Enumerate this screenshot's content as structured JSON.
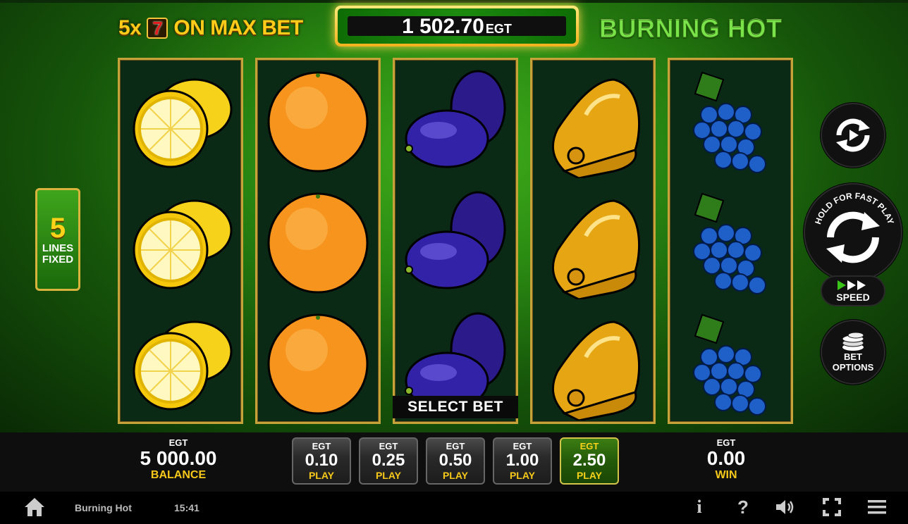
{
  "header": {
    "promo_multiplier": "5x",
    "promo_seven": "7",
    "promo_text": "ON MAX BET",
    "jackpot_amount": "1 502.70",
    "jackpot_currency": "EGT",
    "game_title": "BURNING HOT"
  },
  "reels": [
    {
      "symbols": [
        "lemon",
        "lemon",
        "lemon"
      ]
    },
    {
      "symbols": [
        "orange",
        "orange",
        "orange"
      ]
    },
    {
      "symbols": [
        "plum",
        "plum",
        "plum"
      ]
    },
    {
      "symbols": [
        "bell",
        "bell",
        "bell"
      ]
    },
    {
      "symbols": [
        "grapes",
        "grapes",
        "grapes"
      ]
    }
  ],
  "lines": {
    "count": "5",
    "label_line1": "LINES",
    "label_line2": "FIXED"
  },
  "controls": {
    "autoplay_icon": "autoplay-icon",
    "spin_hold_text": "HOLD FOR FAST PLAY",
    "speed_label": "SPEED",
    "bet_options_line1": "BET",
    "bet_options_line2": "OPTIONS"
  },
  "select_bet": "SELECT BET",
  "balance": {
    "currency": "EGT",
    "value": "5 000.00",
    "label": "BALANCE"
  },
  "win": {
    "currency": "EGT",
    "value": "0.00",
    "label": "WIN"
  },
  "bets": [
    {
      "currency": "EGT",
      "value": "0.10",
      "label": "PLAY",
      "active": false
    },
    {
      "currency": "EGT",
      "value": "0.25",
      "label": "PLAY",
      "active": false
    },
    {
      "currency": "EGT",
      "value": "0.50",
      "label": "PLAY",
      "active": false
    },
    {
      "currency": "EGT",
      "value": "1.00",
      "label": "PLAY",
      "active": false
    },
    {
      "currency": "EGT",
      "value": "2.50",
      "label": "PLAY",
      "active": true
    }
  ],
  "footer": {
    "game_name": "Burning Hot",
    "time": "15:41",
    "info_icon": "i",
    "help_icon": "?"
  },
  "colors": {
    "accent_gold": "#f6c81a",
    "frame_gold": "#c5a23a",
    "bg_green": "#2a8a12",
    "active_bet_green": "#245a0a"
  }
}
